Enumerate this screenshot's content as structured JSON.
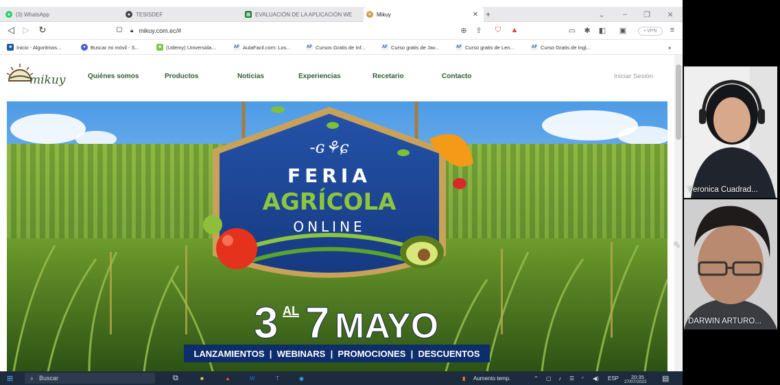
{
  "browser": {
    "tabs": [
      {
        "label": "(3) WhatsApp",
        "icon": "whatsapp-icon"
      },
      {
        "label": "TESISDEF",
        "icon": "github-icon"
      },
      {
        "label": "EVALUACIÓN DE LA APLICACIÓN WE",
        "icon": "sheet-icon"
      },
      {
        "label": "Mikuy",
        "icon": "mikuy-icon"
      }
    ],
    "url": "mikuy.com.ec/#",
    "vpn_label": "• VPN",
    "bookmarks": [
      "Inicio - Algoritmos...",
      "Buscar mi móvil - S...",
      "(Udemy) Universida...",
      "AulaFacil.com: Los...",
      "Cursos Gratis de Inf...",
      "Curso gratis de Jav...",
      "Curso gratis de Len...",
      "Curso Gratis de Ingl..."
    ],
    "bookmarks_more": "»"
  },
  "site": {
    "logo_text": "mikuy",
    "nav": [
      "Quiénes somos",
      "Productos",
      "Noticias",
      "Experiencias",
      "Recetario",
      "Contacto"
    ],
    "login": "Iniciar Sesión",
    "hero": {
      "line1": "FERIA",
      "line2": "AGRÍCOLA",
      "line3": "ONLINE",
      "date_start": "3",
      "date_connector": "AL",
      "date_end": "7",
      "date_month": "MAYO",
      "banner": "LANZAMIENTOS  |  WEBINARS  |  PROMOCIONES  |  DESCUENTOS"
    }
  },
  "taskbar": {
    "search_placeholder": "Buscar",
    "weather": "Aumento temp.",
    "lang": "ESP",
    "time": "20:35",
    "date": "27/07/2022"
  },
  "call": {
    "participants": [
      "Veronica Cuadrad...",
      "DARWIN ARTURO..."
    ]
  },
  "colors": {
    "brand_green": "#2f5e2e",
    "badge_blue": "#1d3f8f",
    "agricola_green": "#8cc63f",
    "taskbar": "#1c2b3d"
  }
}
